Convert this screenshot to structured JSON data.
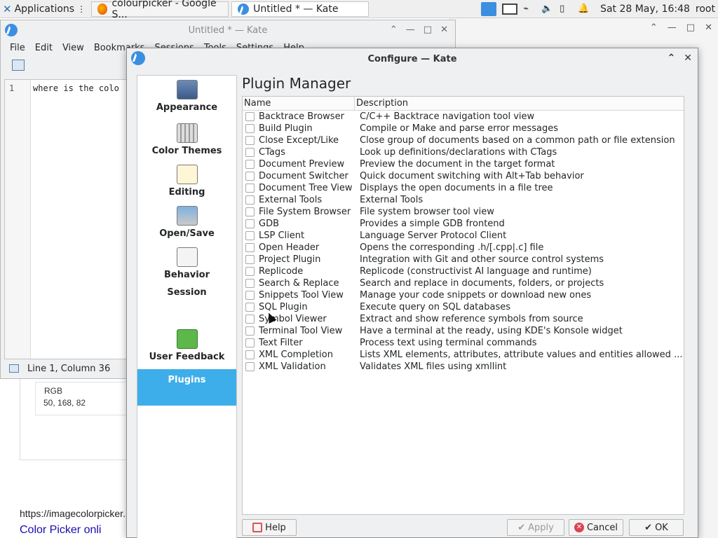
{
  "taskbar": {
    "apps_label": "Applications",
    "tasks": [
      {
        "label": "colourpicker - Google S..."
      },
      {
        "label": "Untitled * — Kate"
      }
    ],
    "clock": "Sat 28 May, 16:48",
    "user": "root"
  },
  "kate": {
    "title": "Untitled * — Kate",
    "menu": [
      "File",
      "Edit",
      "View",
      "Bookmarks",
      "Sessions",
      "Tools",
      "Settings",
      "Help"
    ],
    "line_number": "1",
    "code": "where is the colo",
    "status": "Line 1, Column 36"
  },
  "browser": {
    "rgb_label": "RGB",
    "rgb_value": "50, 168, 82",
    "url_text": "https://imagecolorpicker.",
    "link_text": "Color Picker onli"
  },
  "dialog": {
    "title": "Configure — Kate",
    "heading": "Plugin Manager",
    "sidebar": [
      {
        "label": "Appearance"
      },
      {
        "label": "Color Themes"
      },
      {
        "label": "Editing"
      },
      {
        "label": "Open/Save"
      },
      {
        "label": "Behavior"
      },
      {
        "label": "Session"
      },
      {
        "label": "User Feedback"
      },
      {
        "label": "Plugins"
      }
    ],
    "columns": {
      "name": "Name",
      "description": "Description"
    },
    "plugins": [
      {
        "name": "Backtrace Browser",
        "desc": "C/C++ Backtrace navigation tool view"
      },
      {
        "name": "Build Plugin",
        "desc": "Compile or Make and parse error messages"
      },
      {
        "name": "Close Except/Like",
        "desc": "Close group of documents based on a common path or file extension"
      },
      {
        "name": "CTags",
        "desc": "Look up definitions/declarations with CTags"
      },
      {
        "name": "Document Preview",
        "desc": "Preview the document in the target format"
      },
      {
        "name": "Document Switcher",
        "desc": "Quick document switching with Alt+Tab behavior"
      },
      {
        "name": "Document Tree View",
        "desc": "Displays the open documents in a file tree"
      },
      {
        "name": "External Tools",
        "desc": "External Tools"
      },
      {
        "name": "File System Browser",
        "desc": "File system browser tool view"
      },
      {
        "name": "GDB",
        "desc": "Provides a simple GDB frontend"
      },
      {
        "name": "LSP Client",
        "desc": "Language Server Protocol Client"
      },
      {
        "name": "Open Header",
        "desc": "Opens the corresponding .h/[.cpp|.c] file"
      },
      {
        "name": "Project Plugin",
        "desc": "Integration with Git and other source control systems"
      },
      {
        "name": "Replicode",
        "desc": "Replicode (constructivist AI language and runtime)"
      },
      {
        "name": "Search & Replace",
        "desc": "Search and replace in documents, folders, or projects"
      },
      {
        "name": "Snippets Tool View",
        "desc": "Manage your code snippets or download new ones"
      },
      {
        "name": "SQL Plugin",
        "desc": "Execute query on SQL databases"
      },
      {
        "name": "Symbol Viewer",
        "desc": "Extract and show reference symbols from source"
      },
      {
        "name": "Terminal Tool View",
        "desc": "Have a terminal at the ready, using KDE's Konsole widget"
      },
      {
        "name": "Text Filter",
        "desc": "Process text using terminal commands"
      },
      {
        "name": "XML Completion",
        "desc": "Lists XML elements, attributes, attribute values and entities allowed ..."
      },
      {
        "name": "XML Validation",
        "desc": "Validates XML files using xmllint"
      }
    ],
    "buttons": {
      "help": "Help",
      "apply": "Apply",
      "cancel": "Cancel",
      "ok": "OK"
    }
  },
  "colors": {
    "accent": "#3daee9",
    "window_bg": "#eff0f1",
    "cancel_red": "#da4453"
  }
}
